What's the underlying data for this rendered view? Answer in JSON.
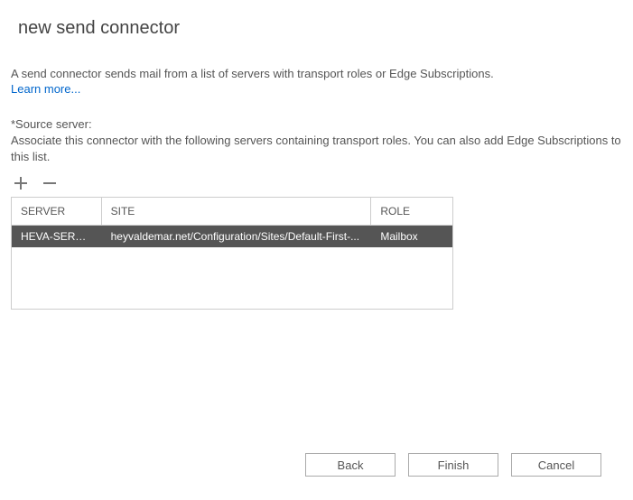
{
  "page": {
    "title": "new send connector",
    "description": "A send connector sends mail from a list of servers with transport roles or Edge Subscriptions.",
    "learn_more": "Learn more..."
  },
  "source": {
    "label": "*Source server:",
    "help": "Associate this connector with the following servers containing transport roles. You can also add Edge Subscriptions to this list."
  },
  "grid": {
    "headers": {
      "server": "SERVER",
      "site": "SITE",
      "role": "ROLE"
    },
    "rows": [
      {
        "server": "HEVA-SERVE...",
        "site": "heyvaldemar.net/Configuration/Sites/Default-First-...",
        "role": "Mailbox"
      }
    ]
  },
  "footer": {
    "back": "Back",
    "finish": "Finish",
    "cancel": "Cancel"
  }
}
